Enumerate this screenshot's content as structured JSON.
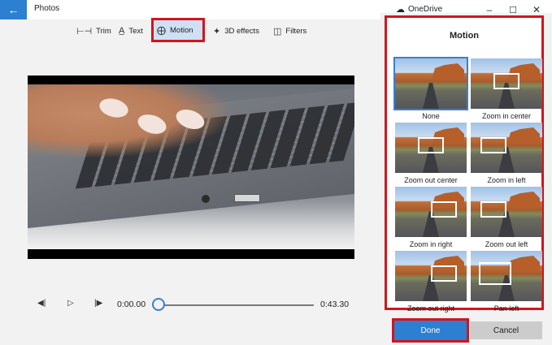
{
  "titlebar": {
    "back_icon": "arrow-left-icon",
    "app_title": "Photos",
    "onedrive_label": "OneDrive",
    "minimize_icon": "minimize-icon",
    "maximize_icon": "maximize-icon",
    "close_icon": "close-icon"
  },
  "toolbar": {
    "items": [
      {
        "label": "Trim",
        "icon": "trim-icon"
      },
      {
        "label": "Text",
        "icon": "text-icon"
      },
      {
        "label": "Motion",
        "icon": "motion-icon",
        "active": true
      },
      {
        "label": "3D effects",
        "icon": "3d-effects-icon"
      },
      {
        "label": "Filters",
        "icon": "filters-icon"
      }
    ]
  },
  "player": {
    "current_time": "0:00.00",
    "total_time": "0:43.30",
    "progress": 0.0
  },
  "motion_panel": {
    "title": "Motion",
    "options": [
      {
        "label": "None",
        "selected": true
      },
      {
        "label": "Zoom in center"
      },
      {
        "label": "Zoom out center"
      },
      {
        "label": "Zoom in left"
      },
      {
        "label": "Zoom in right"
      },
      {
        "label": "Zoom out left"
      },
      {
        "label": "Zoom out right"
      },
      {
        "label": "Pan left"
      }
    ],
    "done_label": "Done",
    "cancel_label": "Cancel"
  },
  "colors": {
    "accent": "#2d7fd1",
    "highlight": "#d4141c",
    "panel_bg": "#f2f2f2"
  }
}
